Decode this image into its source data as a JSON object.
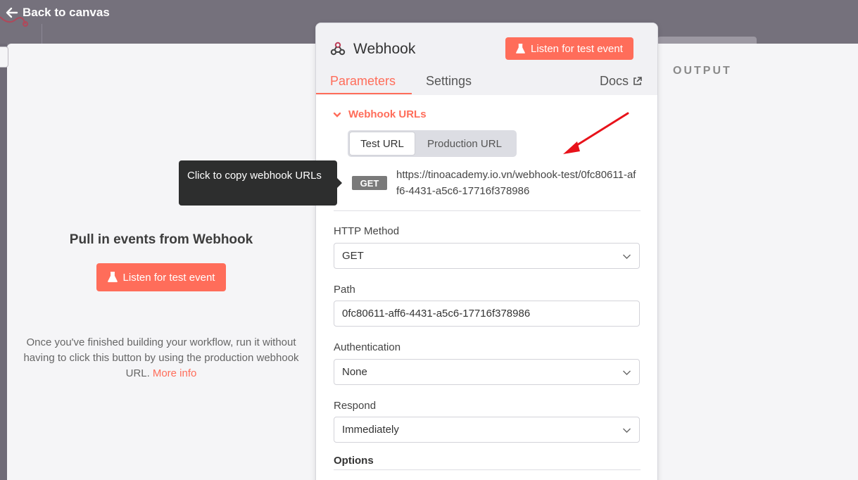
{
  "topbar": {
    "back_label": "Back to canvas"
  },
  "input_pane": {
    "title": "Pull in events from Webhook",
    "listen_button": "Listen for test event",
    "help_text": "Once you've finished building your workflow, run it without having to click this button by using the production webhook URL.",
    "more_info": "More info"
  },
  "output_pane": {
    "label": "OUTPUT"
  },
  "panel": {
    "node_title": "Webhook",
    "listen_button": "Listen for test event",
    "tabs": {
      "parameters": "Parameters",
      "settings": "Settings",
      "docs": "Docs"
    },
    "webhook_urls": {
      "section_label": "Webhook URLs",
      "test_url": "Test URL",
      "production_url": "Production URL",
      "method": "GET",
      "url": "https://tinoacademy.io.vn/webhook-test/0fc80611-aff6-4431-a5c6-17716f378986"
    },
    "fields": {
      "http_method_label": "HTTP Method",
      "http_method_value": "GET",
      "path_label": "Path",
      "path_value": "0fc80611-aff6-4431-a5c6-17716f378986",
      "auth_label": "Authentication",
      "auth_value": "None",
      "respond_label": "Respond",
      "respond_value": "Immediately",
      "options_label": "Options"
    }
  },
  "tooltip": {
    "text": "Click to copy webhook URLs"
  },
  "colors": {
    "accent": "#ff6d5a",
    "tooltip_bg": "#2d2e2e",
    "annotation": "#e8121a"
  },
  "icons": [
    "arrow-left-icon",
    "flask-icon",
    "webhook-icon",
    "external-link-icon",
    "chevron-down-icon"
  ]
}
